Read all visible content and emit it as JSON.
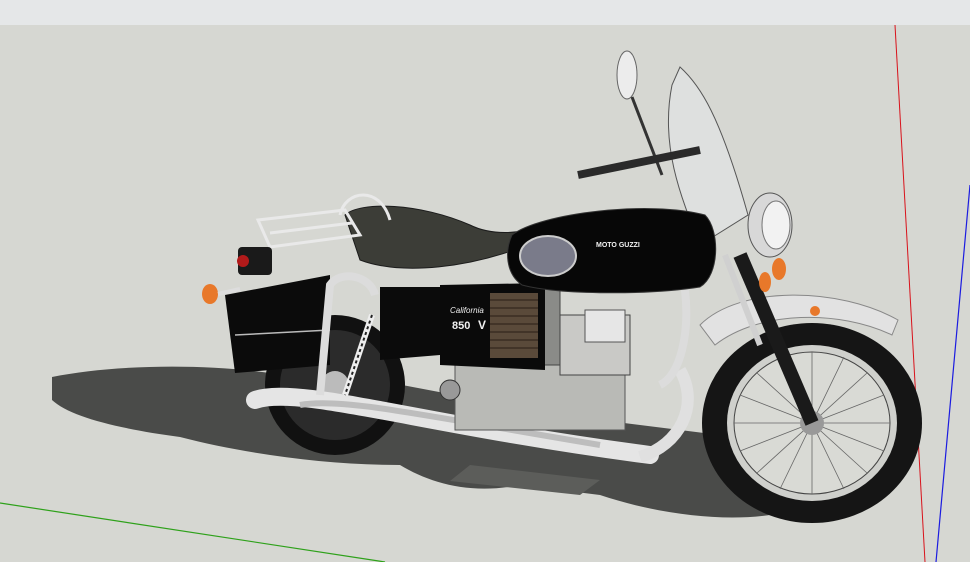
{
  "window": {
    "title": ""
  },
  "model": {
    "brand": "MOTO GUZZI",
    "model_name": "California",
    "displacement": "850",
    "generation_mark": "V"
  },
  "colors": {
    "background": "#d6d7d2",
    "axis_red": "#d8121b",
    "axis_green": "#2ea11a",
    "axis_blue": "#1b1be0",
    "body_black": "#0b0b0b",
    "chrome": "#e9e9e9",
    "shadow": "#4a4b49"
  },
  "icons": {
    "axes": "axes-icon"
  }
}
